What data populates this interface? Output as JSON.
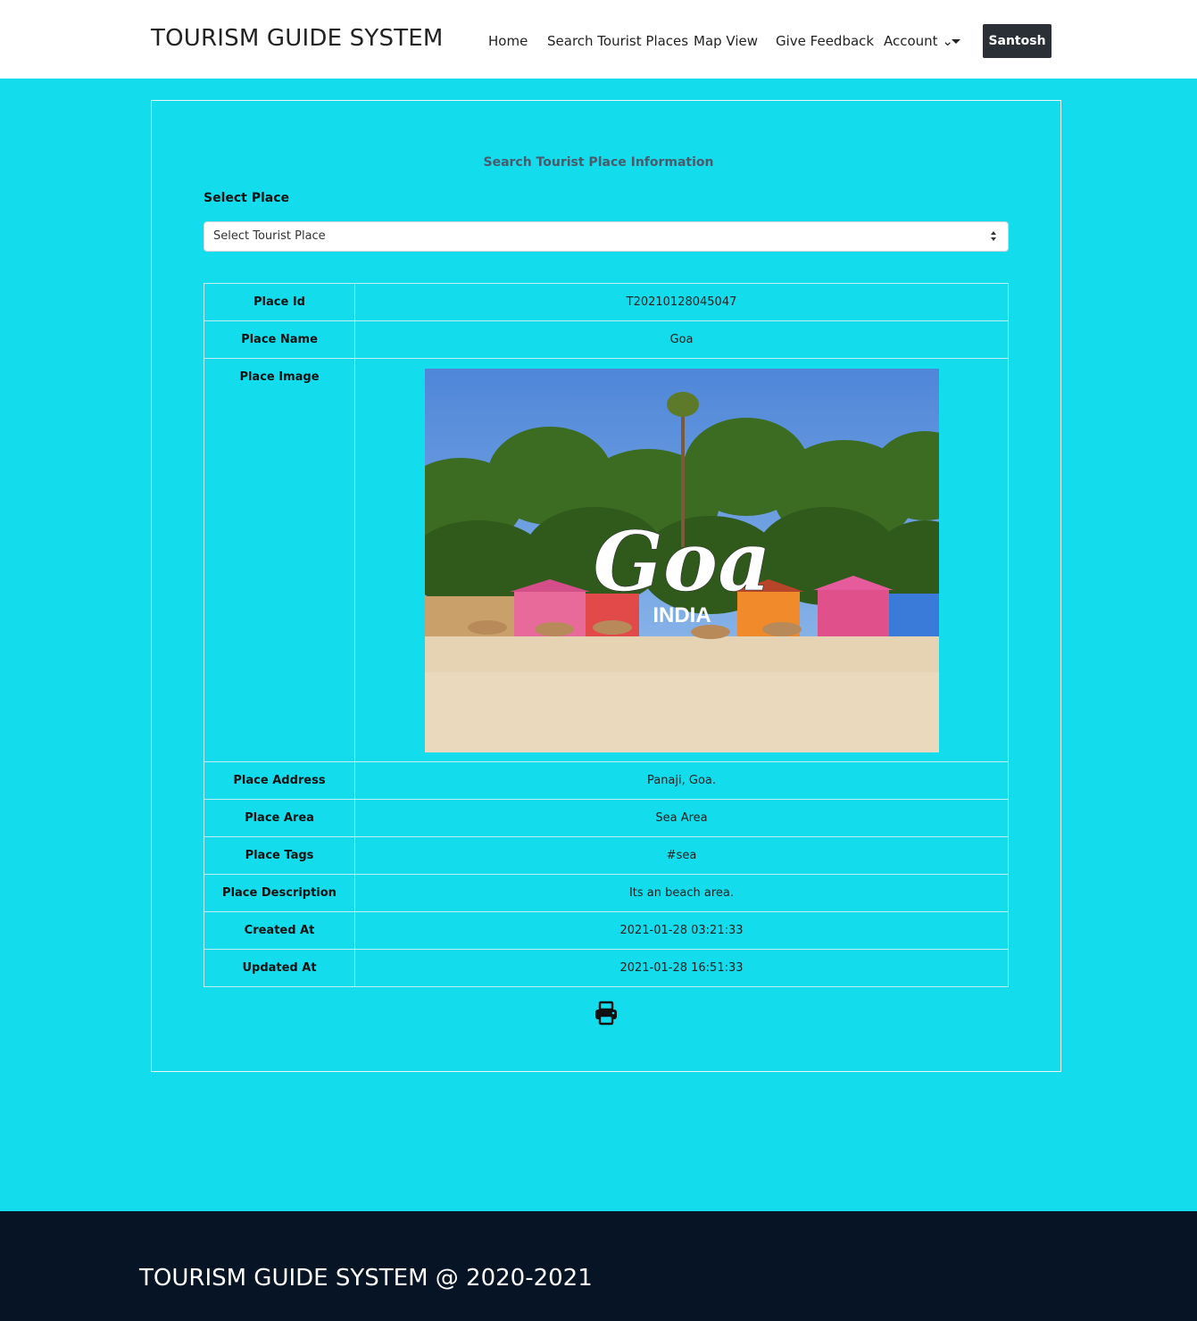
{
  "header": {
    "brand": "TOURISM GUIDE SYSTEM",
    "nav": [
      "Home",
      "Search Tourist Places",
      "Map View",
      "Give Feedback",
      "Account ⌄"
    ],
    "user": "Santosh"
  },
  "search": {
    "title": "Search Tourist Place Information",
    "select_label": "Select Place",
    "select_value": "Select Tourist Place"
  },
  "details": [
    {
      "key": "Place Id",
      "value": "T20210128045047"
    },
    {
      "key": "Place Name",
      "value": "Goa"
    },
    {
      "key": "Place Image",
      "value": ""
    },
    {
      "key": "Place Address",
      "value": "Panaji, Goa."
    },
    {
      "key": "Place Area",
      "value": "Sea Area"
    },
    {
      "key": "Place Tags",
      "value": "#sea"
    },
    {
      "key": "Place Description",
      "value": "Its an beach area."
    },
    {
      "key": "Created At",
      "value": "2021-01-28 03:21:33"
    },
    {
      "key": "Updated At",
      "value": "2021-01-28 16:51:33"
    }
  ],
  "image_text": {
    "main": "Goa",
    "sub": "INDIA"
  },
  "icons": {
    "print": "print-icon"
  },
  "footer": {
    "text": "TOURISM GUIDE SYSTEM @ 2020-2021"
  },
  "colors": {
    "background": "#13dded",
    "footer": "#071426",
    "user_button": "#2b2f36"
  }
}
